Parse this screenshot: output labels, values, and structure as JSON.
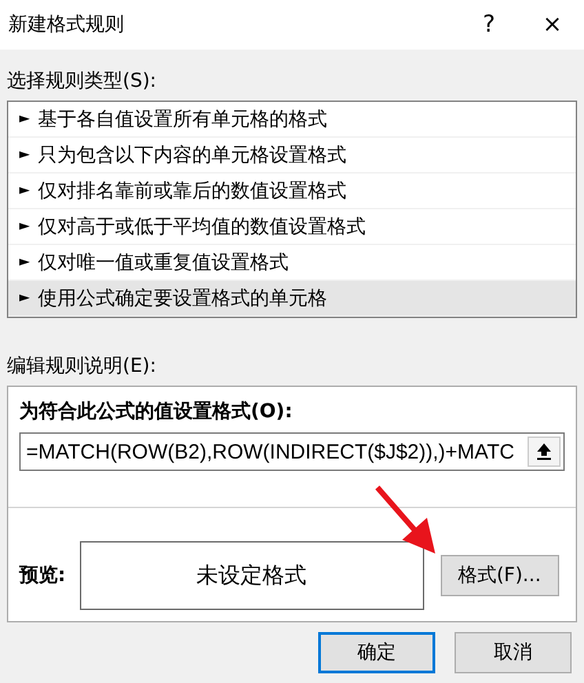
{
  "window": {
    "title": "新建格式规则",
    "help": "?",
    "close": "×"
  },
  "rule_type": {
    "label": "选择规则类型(S):",
    "items": [
      {
        "marker": "►",
        "label": "基于各自值设置所有单元格的格式",
        "selected": false
      },
      {
        "marker": "►",
        "label": "只为包含以下内容的单元格设置格式",
        "selected": false
      },
      {
        "marker": "►",
        "label": "仅对排名靠前或靠后的数值设置格式",
        "selected": false
      },
      {
        "marker": "►",
        "label": "仅对高于或低于平均值的数值设置格式",
        "selected": false
      },
      {
        "marker": "►",
        "label": "仅对唯一值或重复值设置格式",
        "selected": false
      },
      {
        "marker": "►",
        "label": "使用公式确定要设置格式的单元格",
        "selected": true
      }
    ]
  },
  "description": {
    "label": "编辑规则说明(E):",
    "formula_label": "为符合此公式的值设置格式(O):",
    "formula": "=MATCH(ROW(B2),ROW(INDIRECT($J$2)),)+MATC",
    "preview_label": "预览:",
    "preview_text": "未设定格式",
    "format_button": "格式(F)..."
  },
  "buttons": [
    {
      "label": "确定",
      "default": true
    },
    {
      "label": "取消",
      "default": false
    }
  ]
}
